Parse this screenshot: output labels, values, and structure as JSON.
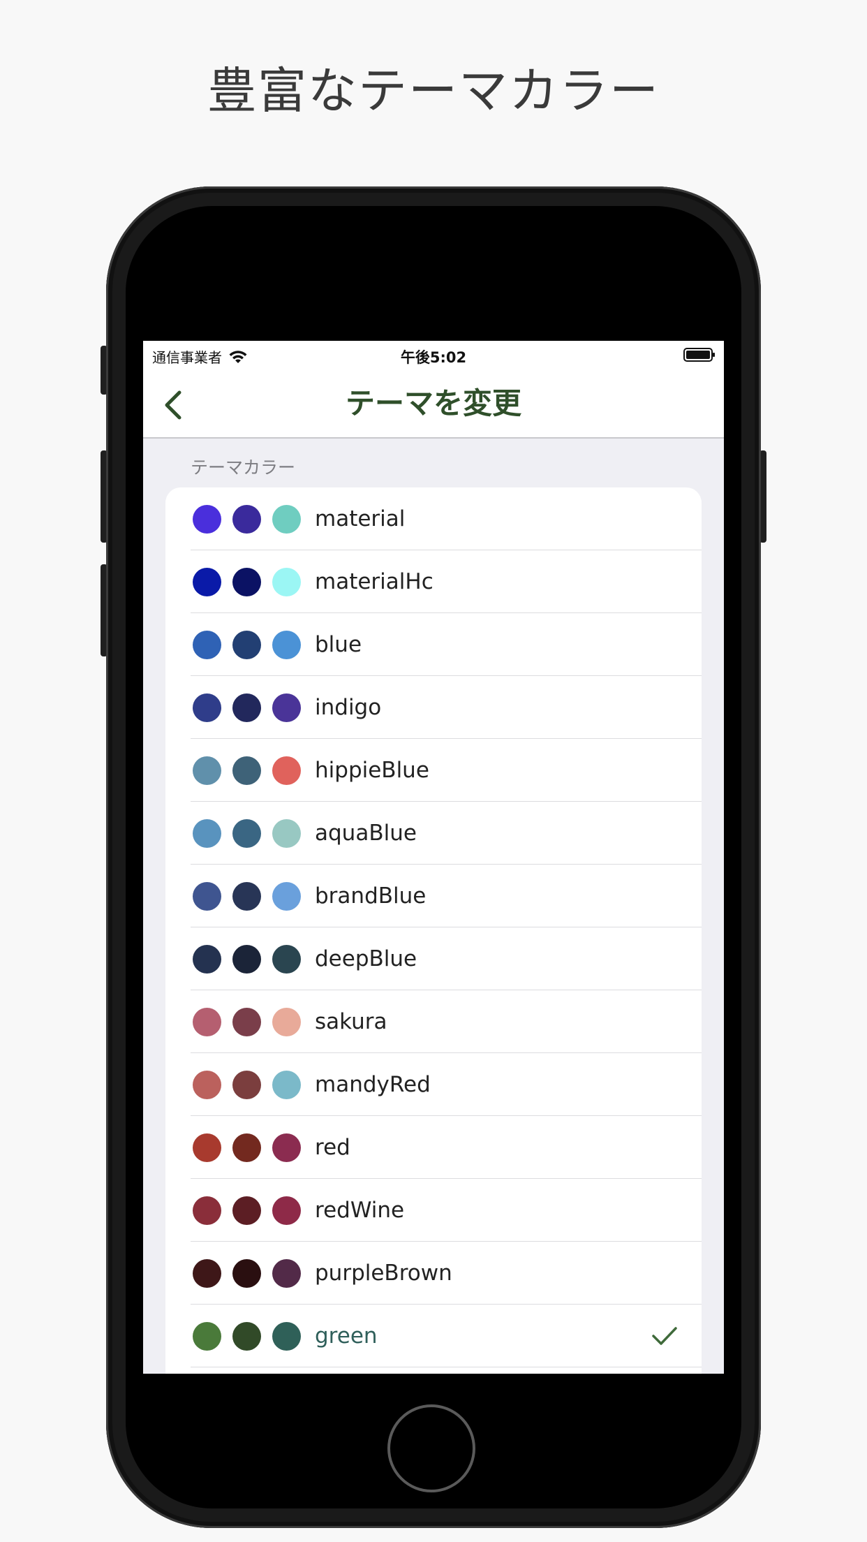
{
  "headline": "豊富なテーマカラー",
  "status_bar": {
    "carrier": "通信事業者",
    "time": "午後5:02"
  },
  "nav": {
    "title": "テーマを変更"
  },
  "section_header": "テーマカラー",
  "themes": [
    {
      "name": "material",
      "colors": [
        "#4a2fdc",
        "#3a2a9c",
        "#6fcdc0"
      ]
    },
    {
      "name": "materialHc",
      "colors": [
        "#0a1aa8",
        "#0b1264",
        "#9bf6f4"
      ]
    },
    {
      "name": "blue",
      "colors": [
        "#2f62b5",
        "#223f73",
        "#4b92d6"
      ]
    },
    {
      "name": "indigo",
      "colors": [
        "#2f3d8a",
        "#22285c",
        "#4a3498"
      ]
    },
    {
      "name": "hippieBlue",
      "colors": [
        "#6090ab",
        "#3e6278",
        "#e0625c"
      ]
    },
    {
      "name": "aquaBlue",
      "colors": [
        "#5993be",
        "#3a6683",
        "#98c8c2"
      ]
    },
    {
      "name": "brandBlue",
      "colors": [
        "#3f5590",
        "#283556",
        "#6aa0dc"
      ]
    },
    {
      "name": "deepBlue",
      "colors": [
        "#243250",
        "#1b2438",
        "#2a4550"
      ]
    },
    {
      "name": "sakura",
      "colors": [
        "#b55f70",
        "#7a3e4a",
        "#e8aa99"
      ]
    },
    {
      "name": "mandyRed",
      "colors": [
        "#bb615d",
        "#7b3e3e",
        "#7bb9c9"
      ]
    },
    {
      "name": "red",
      "colors": [
        "#a83a2e",
        "#73291f",
        "#8b2c50"
      ]
    },
    {
      "name": "redWine",
      "colors": [
        "#8a2e3a",
        "#5c1e24",
        "#8e2a48"
      ]
    },
    {
      "name": "purpleBrown",
      "colors": [
        "#3e1718",
        "#2a0f10",
        "#522a48"
      ]
    },
    {
      "name": "green",
      "colors": [
        "#4a7a3a",
        "#314a28",
        "#2f6058"
      ],
      "selected": true
    }
  ],
  "icons": {
    "back": "chevron-left-icon",
    "wifi": "wifi-icon",
    "battery": "battery-icon",
    "check": "checkmark-icon"
  },
  "accent_color": "#2f4f2a"
}
